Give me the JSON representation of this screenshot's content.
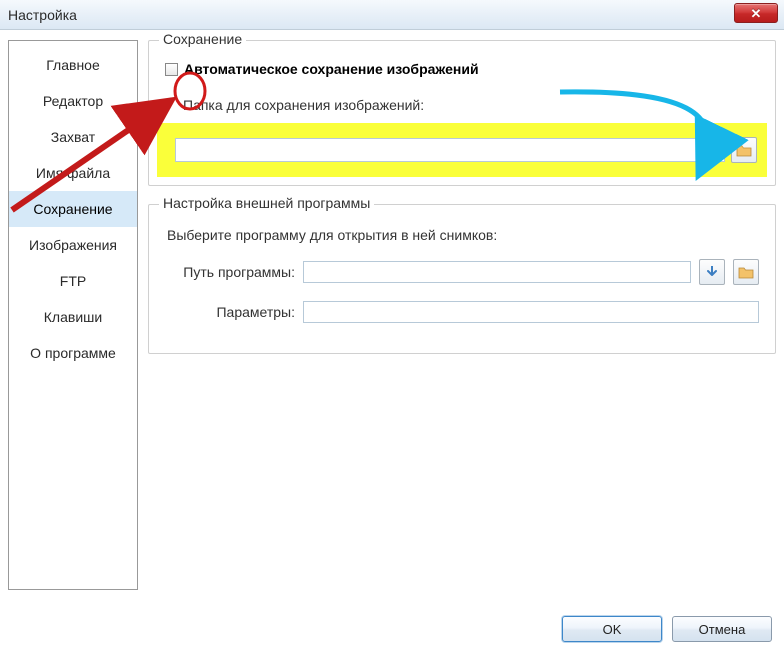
{
  "window": {
    "title": "Настройка"
  },
  "sidebar": {
    "items": [
      {
        "label": "Главное"
      },
      {
        "label": "Редактор"
      },
      {
        "label": "Захват"
      },
      {
        "label": "Имя файла"
      },
      {
        "label": "Сохранение"
      },
      {
        "label": "Изображения"
      },
      {
        "label": "FTP"
      },
      {
        "label": "Клавиши"
      },
      {
        "label": "О программе"
      }
    ],
    "active_index": 4
  },
  "save_group": {
    "title": "Сохранение",
    "autosave_label": "Автоматическое сохранение изображений",
    "autosave_checked": false,
    "folder_label": "Папка для сохранения изображений:",
    "folder_value": ""
  },
  "ext_group": {
    "title": "Настройка внешней программы",
    "select_label": "Выберите программу для открытия в ней снимков:",
    "path_label": "Путь программы:",
    "path_value": "",
    "params_label": "Параметры:",
    "params_value": ""
  },
  "buttons": {
    "ok": "OK",
    "cancel": "Отмена"
  },
  "icons": {
    "folder": "folder-icon",
    "download_arrow": "download-arrow-icon",
    "close": "close-icon"
  },
  "annotations": {
    "red_arrow": "arrow pointing to autosave checkbox",
    "red_circle": "circle around autosave checkbox",
    "blue_arrow": "curved arrow from label to browse button"
  }
}
